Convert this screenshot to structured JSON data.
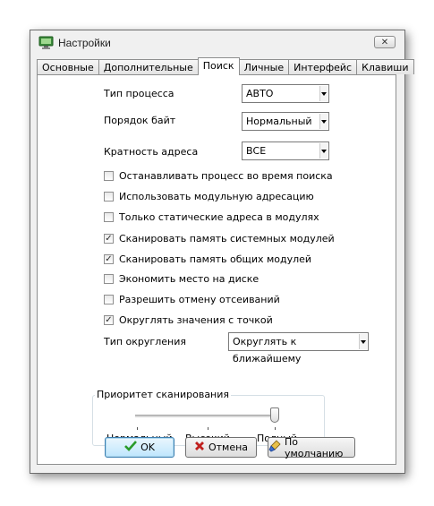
{
  "window": {
    "title": "Настройки",
    "close_glyph": "✕"
  },
  "tabs": [
    {
      "label": "Основные"
    },
    {
      "label": "Дополнительные"
    },
    {
      "label": "Поиск"
    },
    {
      "label": "Личные"
    },
    {
      "label": "Интерфейс"
    },
    {
      "label": "Клавиши"
    }
  ],
  "active_tab": "Поиск",
  "fields": {
    "process_type": {
      "label": "Тип процесса",
      "value": "АВТО"
    },
    "byte_order": {
      "label": "Порядок байт",
      "value": "Нормальный"
    },
    "address_alignment": {
      "label": "Кратность адреса",
      "value": "ВСЕ"
    }
  },
  "options": [
    {
      "label": "Останавливать процесс во время поиска",
      "checked": false
    },
    {
      "label": "Использовать модульную адресацию",
      "checked": false
    },
    {
      "label": "Только статические адреса в модулях",
      "checked": false
    },
    {
      "label": "Сканировать память системных модулей",
      "checked": true
    },
    {
      "label": "Сканировать память общих модулей",
      "checked": true
    },
    {
      "label": "Экономить место на диске",
      "checked": false
    },
    {
      "label": "Разрешить отмену отсеиваний",
      "checked": false
    },
    {
      "label": "Округлять значения с точкой",
      "checked": true
    }
  ],
  "rounding": {
    "label": "Тип округления",
    "value": "Округлять к ближайшему"
  },
  "scan_priority": {
    "title": "Приоритет сканирования",
    "labels": [
      "Нормальный",
      "Высокий",
      "Полный"
    ],
    "selected": "Полный"
  },
  "buttons": {
    "ok": "OK",
    "cancel": "Отмена",
    "defaults": "По умолчанию"
  },
  "colors": {
    "check_icon": "#2a9b2a",
    "cancel_icon": "#c0201e"
  }
}
